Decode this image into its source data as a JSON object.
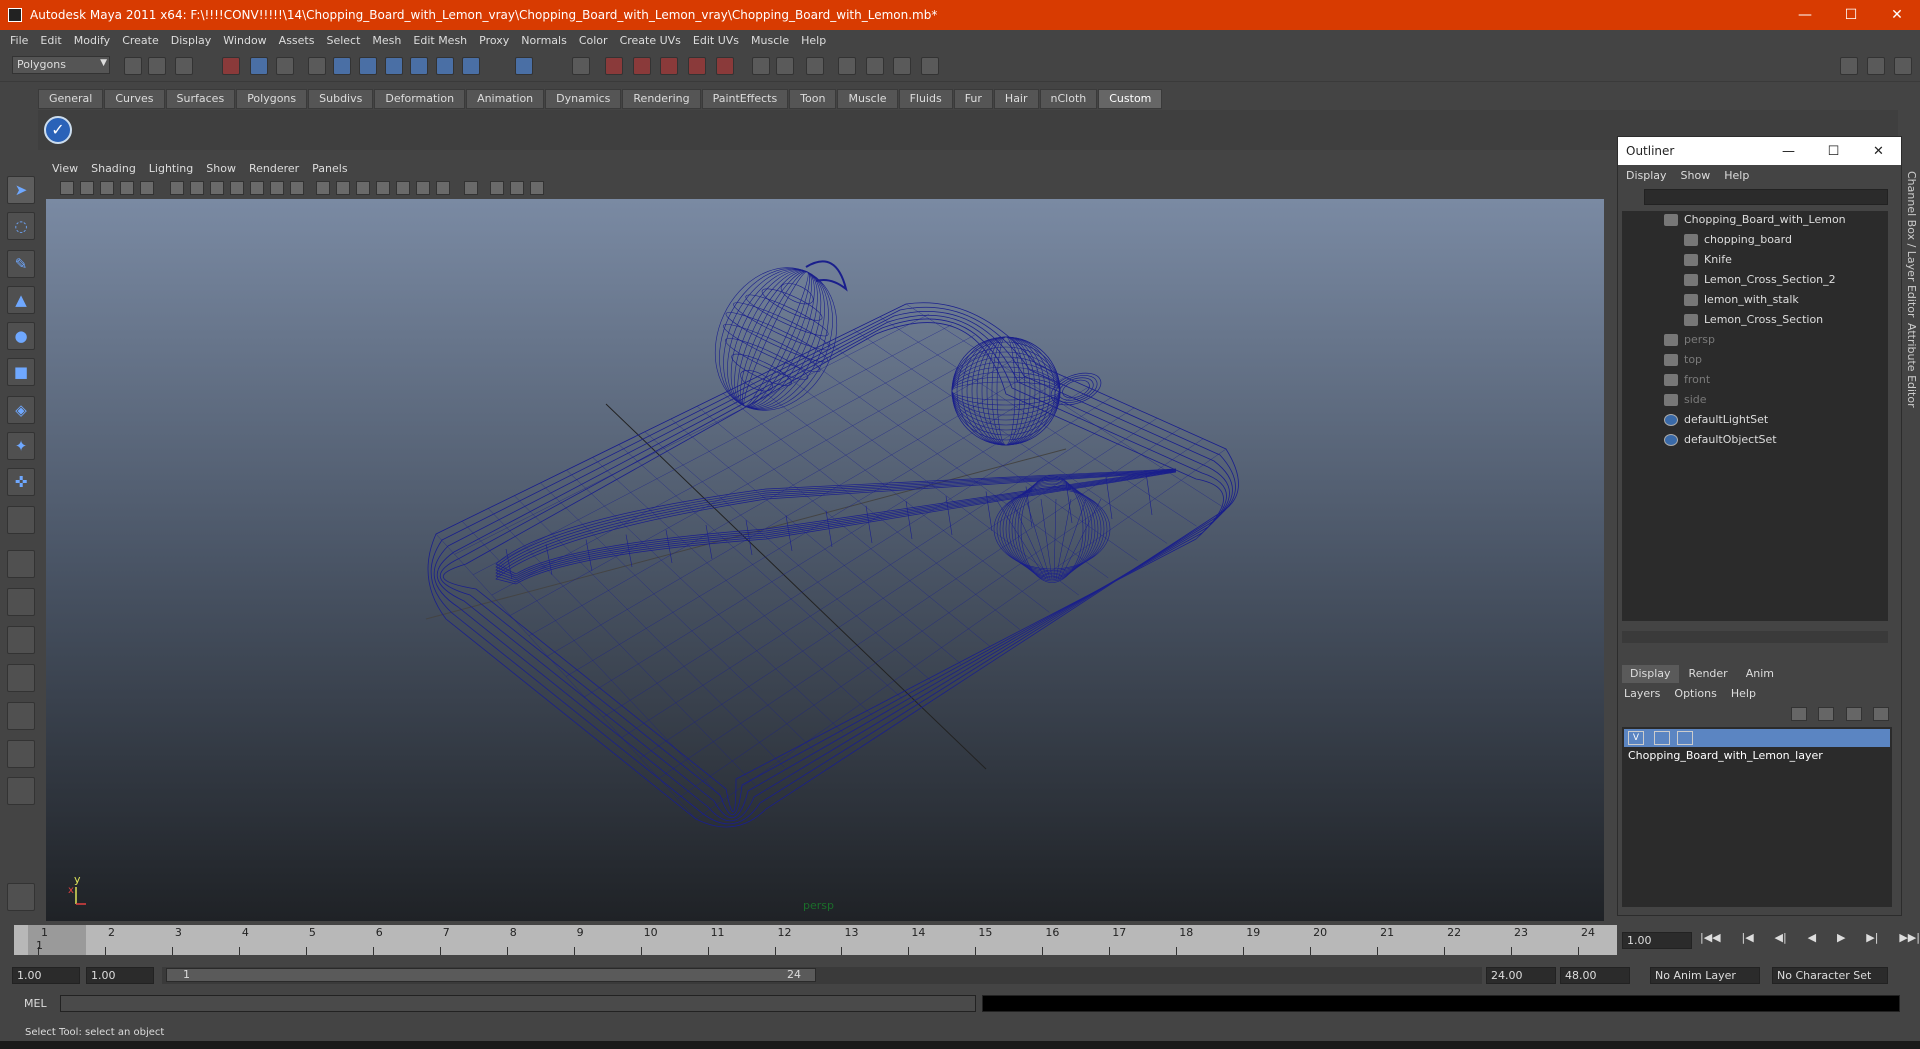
{
  "window": {
    "title": "Autodesk Maya 2011 x64: F:\\!!!!CONV!!!!!\\14\\Chopping_Board_with_Lemon_vray\\Chopping_Board_with_Lemon_vray\\Chopping_Board_with_Lemon.mb*",
    "minimize": "—",
    "maximize": "☐",
    "close": "✕"
  },
  "menubar": [
    "File",
    "Edit",
    "Modify",
    "Create",
    "Display",
    "Window",
    "Assets",
    "Select",
    "Mesh",
    "Edit Mesh",
    "Proxy",
    "Normals",
    "Color",
    "Create UVs",
    "Edit UVs",
    "Muscle",
    "Help"
  ],
  "statusline": {
    "mode": "Polygons"
  },
  "shelf": {
    "tabs": [
      "General",
      "Curves",
      "Surfaces",
      "Polygons",
      "Subdivs",
      "Deformation",
      "Animation",
      "Dynamics",
      "Rendering",
      "PaintEffects",
      "Toon",
      "Muscle",
      "Fluids",
      "Fur",
      "Hair",
      "nCloth",
      "Custom"
    ],
    "active_tab": "Custom"
  },
  "viewport": {
    "menu": [
      "View",
      "Shading",
      "Lighting",
      "Show",
      "Renderer",
      "Panels"
    ],
    "camera_label": "persp",
    "axis_y": "y",
    "axis_x": "x",
    "wire_color": "#1a1f8c"
  },
  "outliner": {
    "title": "Outliner",
    "menu": [
      "Display",
      "Show",
      "Help"
    ],
    "items": [
      {
        "label": "Chopping_Board_with_Lemon",
        "indent": 0,
        "dim": false,
        "kind": "group"
      },
      {
        "label": "chopping_board",
        "indent": 1,
        "dim": false,
        "kind": "mesh"
      },
      {
        "label": "Knife",
        "indent": 1,
        "dim": false,
        "kind": "mesh"
      },
      {
        "label": "Lemon_Cross_Section_2",
        "indent": 1,
        "dim": false,
        "kind": "mesh"
      },
      {
        "label": "lemon_with_stalk",
        "indent": 1,
        "dim": false,
        "kind": "mesh"
      },
      {
        "label": "Lemon_Cross_Section",
        "indent": 1,
        "dim": false,
        "kind": "mesh"
      },
      {
        "label": "persp",
        "indent": 0,
        "dim": true,
        "kind": "camera"
      },
      {
        "label": "top",
        "indent": 0,
        "dim": true,
        "kind": "camera"
      },
      {
        "label": "front",
        "indent": 0,
        "dim": true,
        "kind": "camera"
      },
      {
        "label": "side",
        "indent": 0,
        "dim": true,
        "kind": "camera"
      },
      {
        "label": "defaultLightSet",
        "indent": 0,
        "dim": false,
        "kind": "set"
      },
      {
        "label": "defaultObjectSet",
        "indent": 0,
        "dim": false,
        "kind": "set"
      }
    ]
  },
  "layer_editor": {
    "tabs": [
      "Display",
      "Render",
      "Anim"
    ],
    "active_tab": "Display",
    "menu": [
      "Layers",
      "Options",
      "Help"
    ],
    "layer": {
      "visible": "V",
      "name": "Chopping_Board_with_Lemon_layer"
    }
  },
  "side_tabs": [
    "Channel Box / Layer Editor",
    "Attribute Editor"
  ],
  "timeslider": {
    "frames": [
      1,
      2,
      3,
      4,
      5,
      6,
      7,
      8,
      9,
      10,
      11,
      12,
      13,
      14,
      15,
      16,
      17,
      18,
      19,
      20,
      21,
      22,
      23,
      24
    ],
    "current_label": "1",
    "current_frame": "1.00"
  },
  "playback_controls": [
    "|◀◀",
    "|◀",
    "◀|",
    "◀",
    "▶",
    "▶|",
    "▶▶|"
  ],
  "range": {
    "start": "1.00",
    "playback_start": "1.00",
    "handle_start": "1",
    "handle_end": "24",
    "playback_end": "24.00",
    "end": "48.00",
    "anim_layer": "No Anim Layer",
    "character_set": "No Character Set"
  },
  "commandline": {
    "label": "MEL",
    "value": ""
  },
  "helpline": "Select Tool: select an object"
}
